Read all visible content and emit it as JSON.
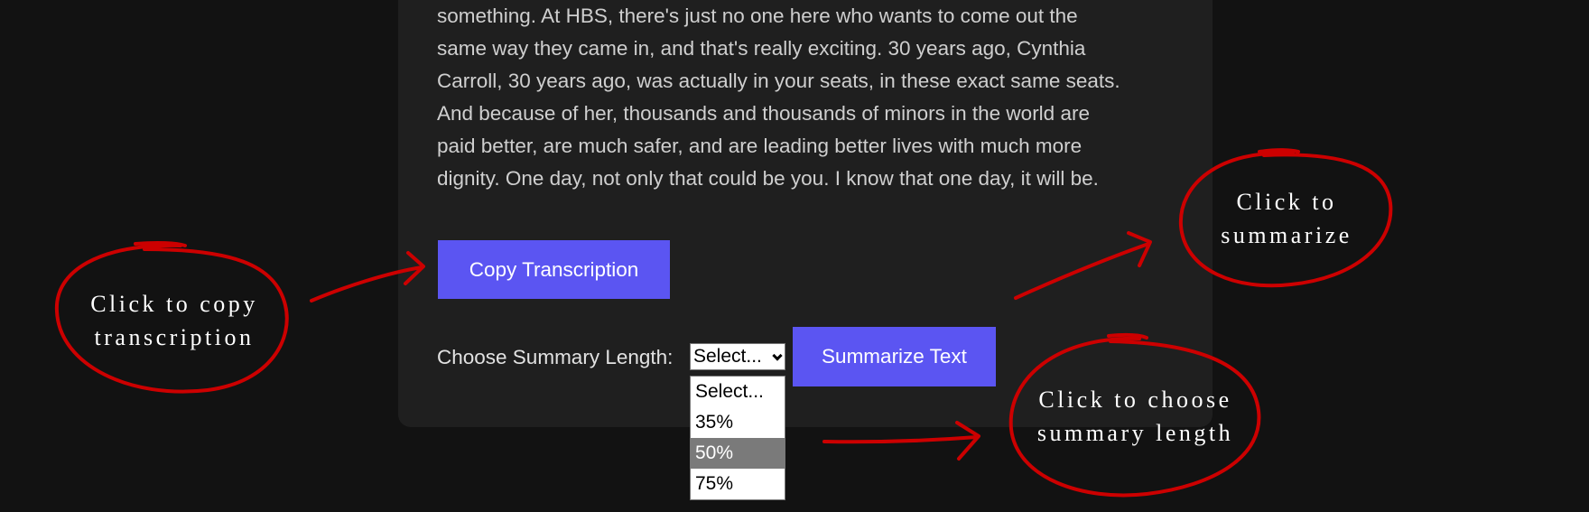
{
  "transcript": {
    "lines": [
      "something. At HBS, there's just no one here who wants to come out the",
      "same way they came in, and that's really exciting. 30 years ago, Cynthia",
      "Carroll, 30 years ago, was actually in your seats, in these exact same seats.",
      "And because of her, thousands and thousands of minors in the world are",
      "paid better, are much safer, and are leading better lives with much more",
      "dignity. One day, not only that could be you. I know that one day, it will be."
    ]
  },
  "controls": {
    "copy_button_label": "Copy Transcription",
    "summary_length_label": "Choose Summary Length:",
    "select_value": "Select...",
    "select_options": [
      "Select...",
      "35%",
      "50%",
      "75%"
    ],
    "highlighted_option": "50%",
    "summarize_button_label": "Summarize Text"
  },
  "annotations": {
    "copy": [
      "Click to copy",
      "transcription"
    ],
    "summarize": [
      "Click to",
      "summarize"
    ],
    "length": [
      "Click to choose",
      "summary length"
    ]
  },
  "colors": {
    "background": "#121212",
    "card": "#1f1f1f",
    "button": "#5b55f2",
    "annotation": "#cc0000"
  }
}
